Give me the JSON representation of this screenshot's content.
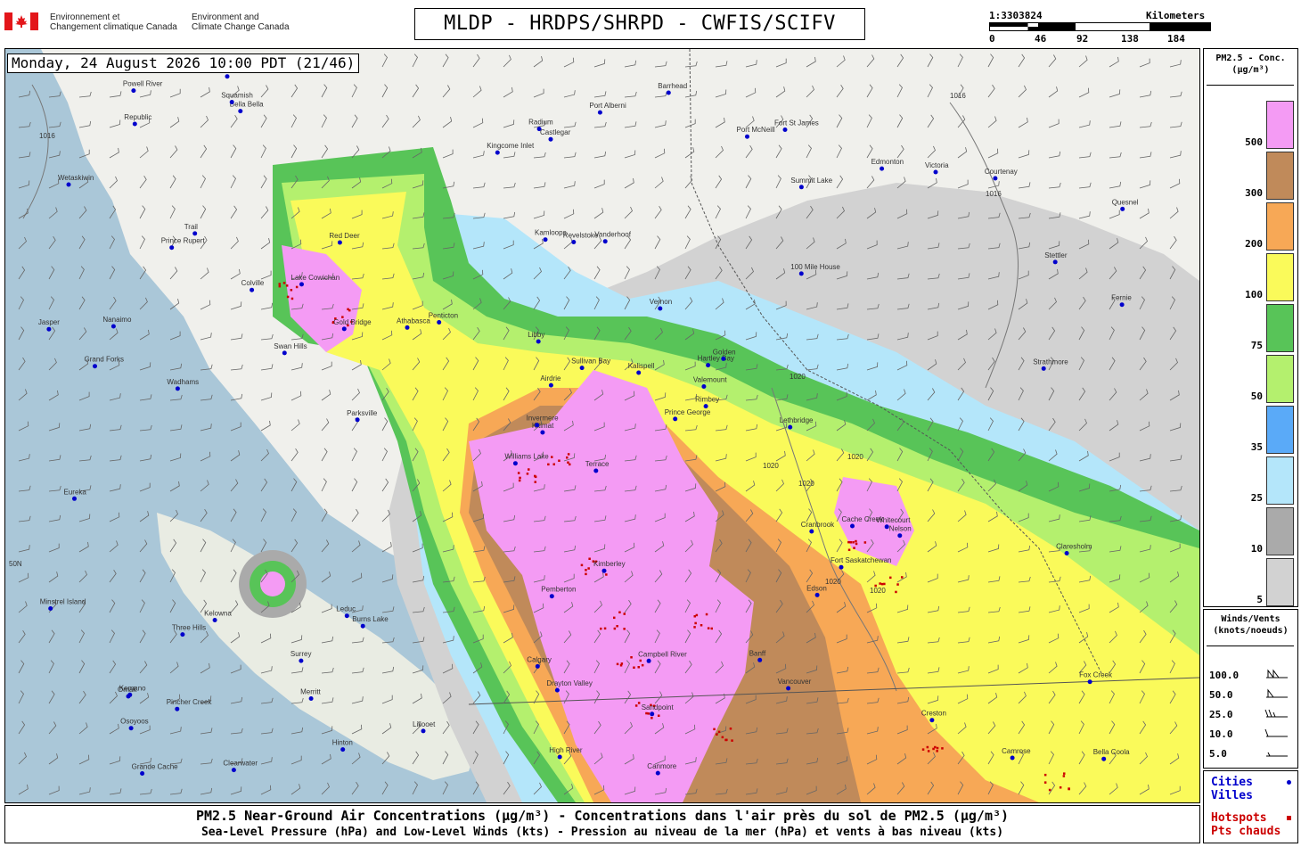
{
  "agency": {
    "fr_line1": "Environnement et",
    "fr_line2": "Changement climatique Canada",
    "en_line1": "Environment and",
    "en_line2": "Climate Change Canada"
  },
  "title": "MLDP - HRDPS/SHRPD - CWFIS/SCIFV",
  "scale": {
    "ratio": "1:3303824",
    "unit": "Kilometers",
    "ticks": [
      "0",
      "46",
      "92",
      "138",
      "184"
    ]
  },
  "datetime": "Monday, 24 August 2026 10:00 PDT (21/46)",
  "legend": {
    "title_line1": "PM2.5 - Conc.",
    "title_line2": "(µg/m³)",
    "levels": [
      {
        "label": "500",
        "color": "#f49bf4"
      },
      {
        "label": "300",
        "color": "#c08a5a"
      },
      {
        "label": "200",
        "color": "#f7a856"
      },
      {
        "label": "100",
        "color": "#fafa5a"
      },
      {
        "label": "75",
        "color": "#58c458"
      },
      {
        "label": "50",
        "color": "#b4f06e"
      },
      {
        "label": "35",
        "color": "#5aaaf8"
      },
      {
        "label": "25",
        "color": "#b4e6fa"
      },
      {
        "label": "10",
        "color": "#aaaaaa"
      },
      {
        "label": "5",
        "color": "#d2d2d2"
      }
    ]
  },
  "winds": {
    "title_line1": "Winds/Vents",
    "title_line2": "(knots/noeuds)",
    "speeds": [
      "100.0",
      "50.0",
      "25.0",
      "10.0",
      "5.0"
    ]
  },
  "keys": {
    "cities_en": "Cities",
    "cities_fr": "Villes",
    "hotspots_en": "Hotspots",
    "hotspots_fr": "Pts chauds",
    "city_color": "#0000cc",
    "hotspot_color": "#cc0000"
  },
  "footer": {
    "line1": "PM2.5 Near-Ground Air Concentrations (µg/m³) - Concentrations dans l'air près du sol de PM2.5 (µg/m³)",
    "line2": "Sea-Level Pressure (hPa) and Low-Level Winds (kts) - Pression au niveau de la mer (hPa) et vents à bas niveau (kts)"
  },
  "map": {
    "cities": [
      {
        "name": "Terrace"
      },
      {
        "name": "Prince Rupert"
      },
      {
        "name": "Kitimat"
      },
      {
        "name": "Kemano"
      },
      {
        "name": "Hartley Bay"
      },
      {
        "name": "Burns Lake"
      },
      {
        "name": "Fort St James"
      },
      {
        "name": "Vanderhoof"
      },
      {
        "name": "Summit Lake"
      },
      {
        "name": "Prince George"
      },
      {
        "name": "Bella Bella"
      },
      {
        "name": "Bella Coola"
      },
      {
        "name": "Wadhams"
      },
      {
        "name": "Quesnel"
      },
      {
        "name": "Williams Lake"
      },
      {
        "name": "100 Mile House"
      },
      {
        "name": "Clearwater"
      },
      {
        "name": "Kamloops"
      },
      {
        "name": "Vernon"
      },
      {
        "name": "Kelowna"
      },
      {
        "name": "Penticton"
      },
      {
        "name": "Osoyoos"
      },
      {
        "name": "Merritt"
      },
      {
        "name": "Revelstoke"
      },
      {
        "name": "Golden"
      },
      {
        "name": "Nelson"
      },
      {
        "name": "Trail"
      },
      {
        "name": "Castlegar"
      },
      {
        "name": "Grand Forks"
      },
      {
        "name": "Cranbrook"
      },
      {
        "name": "Fernie"
      },
      {
        "name": "Invermere"
      },
      {
        "name": "Calgary"
      },
      {
        "name": "Airdrie"
      },
      {
        "name": "Red Deer"
      },
      {
        "name": "Edmonton"
      },
      {
        "name": "Leduc"
      },
      {
        "name": "Camrose"
      },
      {
        "name": "Fox Creek"
      },
      {
        "name": "Whitecourt"
      },
      {
        "name": "Barrhead"
      },
      {
        "name": "Athabasca"
      },
      {
        "name": "Swan Hills"
      },
      {
        "name": "Edson"
      },
      {
        "name": "Hinton"
      },
      {
        "name": "Jasper"
      },
      {
        "name": "Valemount"
      },
      {
        "name": "Grande Cache"
      },
      {
        "name": "Drayton Valley"
      },
      {
        "name": "Rimbey"
      },
      {
        "name": "Three Hills"
      },
      {
        "name": "Stettler"
      },
      {
        "name": "Wetaskiwin"
      },
      {
        "name": "Fort Saskatchewan"
      },
      {
        "name": "Vancouver"
      },
      {
        "name": "Surrey"
      },
      {
        "name": "Squamish"
      },
      {
        "name": "Powell River"
      },
      {
        "name": "Campbell River"
      },
      {
        "name": "Courtenay"
      },
      {
        "name": "Port Alberni"
      },
      {
        "name": "Parksville"
      },
      {
        "name": "Nanaimo"
      },
      {
        "name": "Lake Cowichan"
      },
      {
        "name": "Victoria"
      },
      {
        "name": "Bellingham"
      },
      {
        "name": "Port McNeill"
      },
      {
        "name": "Kingcome Inlet"
      },
      {
        "name": "Sullivan Bay"
      },
      {
        "name": "Minstrel Island"
      },
      {
        "name": "Pemberton"
      },
      {
        "name": "Lillooet"
      },
      {
        "name": "Cache Creek"
      },
      {
        "name": "Gold Bridge"
      },
      {
        "name": "Omak"
      },
      {
        "name": "Republic"
      },
      {
        "name": "Colville"
      },
      {
        "name": "Eureka"
      },
      {
        "name": "Libby"
      },
      {
        "name": "Sandpoint"
      },
      {
        "name": "Kalispell"
      },
      {
        "name": "Pincher Creek"
      },
      {
        "name": "Lethbridge"
      },
      {
        "name": "Claresholm"
      },
      {
        "name": "High River"
      },
      {
        "name": "Strathmore"
      },
      {
        "name": "Kimberley"
      },
      {
        "name": "Creston"
      },
      {
        "name": "Canmore"
      },
      {
        "name": "Banff"
      },
      {
        "name": "Radium"
      }
    ],
    "isobar_labels": [
      "1016",
      "1016",
      "1016",
      "1020",
      "1020",
      "1020",
      "1020",
      "1020",
      "1020"
    ],
    "lat_label": "50N"
  }
}
